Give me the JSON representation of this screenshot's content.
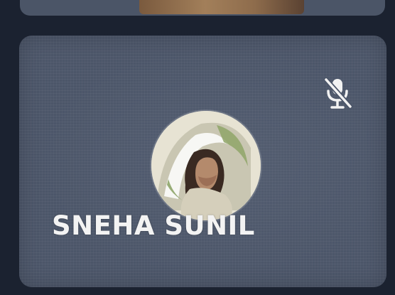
{
  "participant": {
    "name": "SNEHA SUNIL",
    "mic_state": "muted",
    "mic_icon": "mic-off-icon",
    "avatar": "profile-photo"
  },
  "colors": {
    "background": "#1b2230",
    "tile": "#4c5669",
    "name_text": "#f3f3f3",
    "icon": "#f2f2f2"
  }
}
